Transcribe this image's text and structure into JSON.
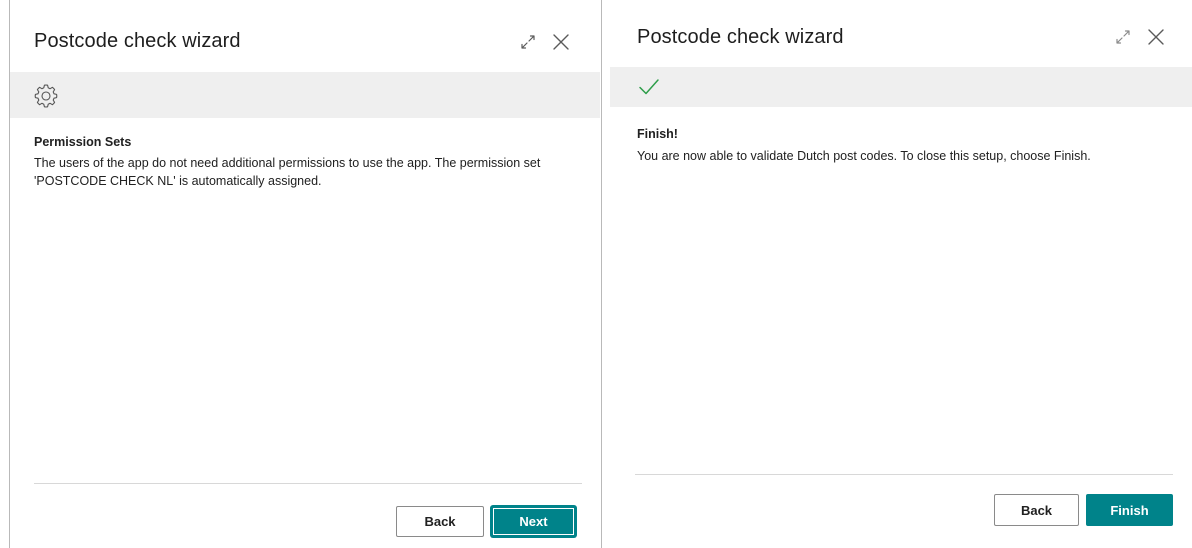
{
  "left_panel": {
    "title": "Postcode check wizard",
    "banner_icon": "gear-icon",
    "step_heading": "Permission Sets",
    "step_text": "The users of the app do not need additional permissions to use the app. The permission set 'POSTCODE CHECK NL' is automatically assigned.",
    "back_label": "Back",
    "next_label": "Next"
  },
  "right_panel": {
    "title": "Postcode check wizard",
    "banner_icon": "checkmark-icon",
    "step_heading": "Finish!",
    "step_text": "You are now able to validate Dutch post codes. To close this setup, choose Finish.",
    "back_label": "Back",
    "finish_label": "Finish"
  },
  "colors": {
    "accent": "#00838a",
    "banner_bg": "#efefef",
    "success": "#2e9e4a"
  }
}
